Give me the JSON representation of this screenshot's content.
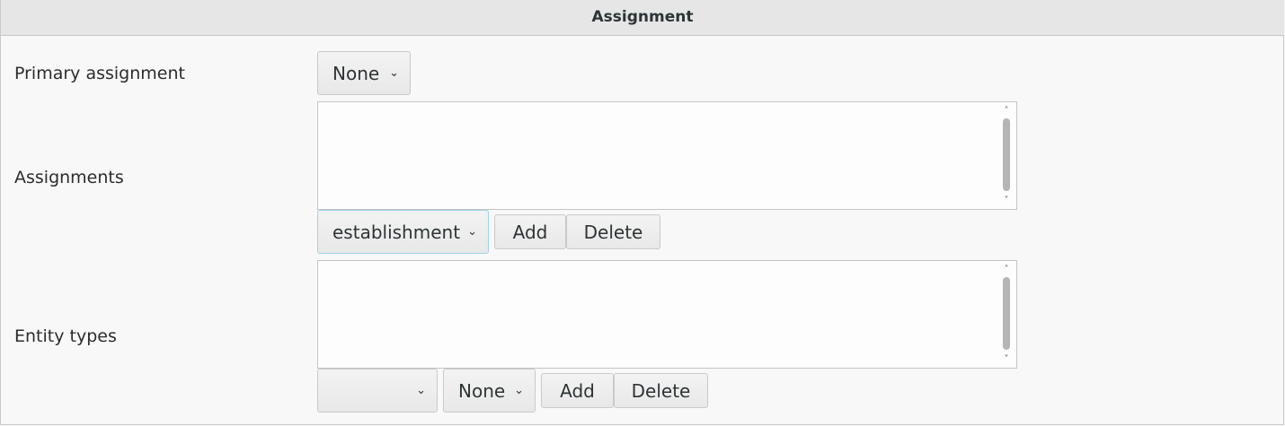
{
  "header": {
    "title": "Assignment"
  },
  "primary": {
    "label": "Primary assignment",
    "select_value": "None"
  },
  "assignments": {
    "label": "Assignments",
    "select_value": "establishment",
    "add_label": "Add",
    "delete_label": "Delete"
  },
  "entity_types": {
    "label": "Entity types",
    "select1_value": "",
    "select2_value": "None",
    "add_label": "Add",
    "delete_label": "Delete"
  },
  "icons": {
    "chevron": "⌄",
    "up": "˄",
    "down": "˅"
  }
}
